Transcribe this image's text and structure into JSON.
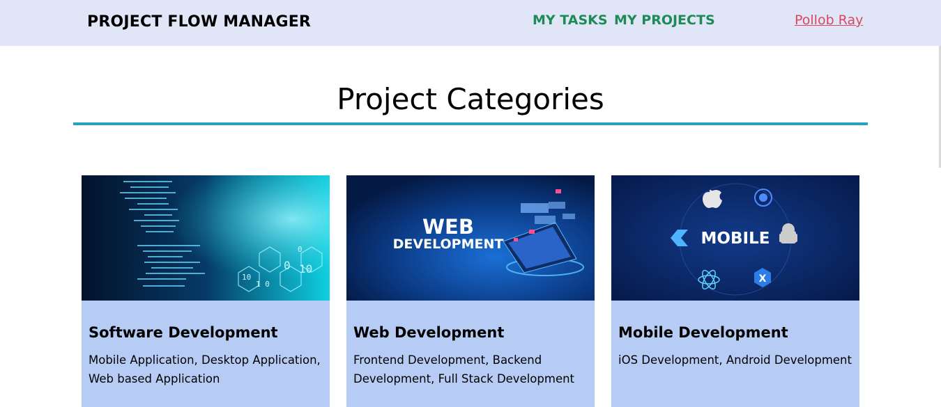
{
  "header": {
    "brand": "PROJECT FLOW MANAGER",
    "nav": {
      "tasks": "MY TASKS",
      "projects": "MY PROJECTS"
    },
    "user": "Pollob Ray"
  },
  "main": {
    "title": "Project Categories",
    "categories": [
      {
        "name": "Software Development",
        "description": "Mobile Application, Desktop Application, Web based Application",
        "image_icon": "code-screen-image"
      },
      {
        "name": "Web Development",
        "description": "Frontend Development, Backend Development, Full Stack Development",
        "image_icon": "web-laptop-image",
        "image_text": [
          "WEB",
          "DEVELOPMENT"
        ]
      },
      {
        "name": "Mobile Development",
        "description": "iOS Development, Android Development",
        "image_icon": "mobile-platforms-image",
        "image_text": "MOBILE"
      }
    ]
  },
  "colors": {
    "navbar_bg": "#e0e6f7",
    "nav_link": "#1e8a55",
    "user_link": "#d9465e",
    "title_rule": "#25a2be",
    "card_bg": "#b7ccf5"
  }
}
